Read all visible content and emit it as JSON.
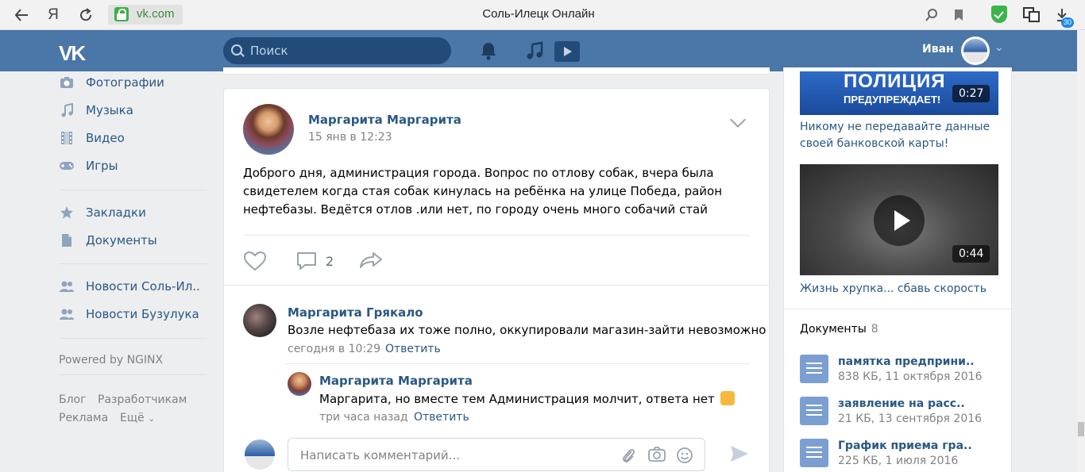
{
  "browser": {
    "back_icon": "back-arrow-icon",
    "yandex_label": "Я",
    "reload_icon": "reload-icon",
    "url": "vk.com",
    "page_title": "Соль-Илецк Онлайн",
    "downloads_badge": "30"
  },
  "header": {
    "logo": "VK",
    "search_placeholder": "Поиск",
    "user_name": "Иван"
  },
  "sidebar": {
    "items": [
      {
        "label": "Фотографии",
        "icon": "camera-icon"
      },
      {
        "label": "Музыка",
        "icon": "music-note-icon"
      },
      {
        "label": "Видео",
        "icon": "film-icon"
      },
      {
        "label": "Игры",
        "icon": "gamepad-icon"
      },
      {
        "label": "Закладки",
        "icon": "star-icon"
      },
      {
        "label": "Документы",
        "icon": "document-icon"
      },
      {
        "label": "Новости Соль-Ил..",
        "icon": "group-icon"
      },
      {
        "label": "Новости Бузулука",
        "icon": "group-icon"
      }
    ],
    "powered": "Powered by NGINX",
    "footer": {
      "blog": "Блог",
      "developers": "Разработчикам",
      "ads": "Реклама",
      "more": "Ещё"
    }
  },
  "post": {
    "author": "Маргарита Маргарита",
    "date": "15 янв в 12:23",
    "text": "Доброго дня, администрация города. Вопрос по отлову собак, вчера была свидетелем когда стая собак кинулась на ребёнка на улице Победа, район нефтебазы. Ведётся отлов .или нет, по городу очень много собачий стай",
    "comments_count": "2"
  },
  "comments": [
    {
      "author": "Маргарита Грякало",
      "text": "Возле нефтебаза их тоже полно, оккупировали магазин-зайти невозможно",
      "time": "сегодня в 10:29",
      "reply": "Ответить"
    },
    {
      "author": "Маргарита Маргарита",
      "text": "Маргарита, но вместе тем Администрация молчит, ответа нет",
      "time": "три часа назад",
      "reply": "Ответить"
    }
  ],
  "comment_input": {
    "placeholder": "Написать комментарий..."
  },
  "right": {
    "video1": {
      "thumb_title": "ПОЛИЦИЯ",
      "thumb_sub": "ПРЕДУПРЕЖДАЕТ!",
      "duration": "0:27",
      "title": "Никому не передавайте данные своей банковской карты!"
    },
    "video2": {
      "duration": "0:44",
      "title": "Жизнь хрупка... сбавь скорость"
    },
    "docs": {
      "header": "Документы",
      "count": "8",
      "items": [
        {
          "title": "памятка предприни..",
          "meta": "838 КБ, 11 октября 2016"
        },
        {
          "title": "заявление на расс..",
          "meta": "21 КБ, 13 сентября 2016"
        },
        {
          "title": "График приема гра..",
          "meta": "225 КБ, 1 июля 2016"
        }
      ]
    }
  },
  "colors": {
    "vk_blue": "#4a76a8",
    "link": "#2a5885",
    "muted": "#828282",
    "bg": "#edeef0"
  }
}
